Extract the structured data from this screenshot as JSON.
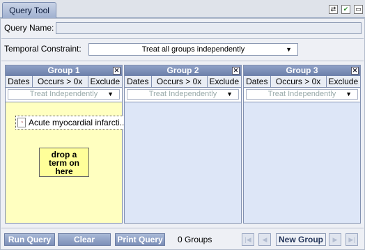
{
  "tab": {
    "label": "Query Tool"
  },
  "toolbar_icons": [
    "export-icon",
    "checkmark-icon",
    "restore-window-icon"
  ],
  "query_name": {
    "label": "Query Name:",
    "value": ""
  },
  "temporal": {
    "label": "Temporal Constraint:",
    "value": "Treat all groups independently"
  },
  "groups": [
    {
      "title": "Group 1",
      "tabs": [
        "Dates",
        "Occurs > 0x",
        "Exclude"
      ],
      "timing": "Treat Independently",
      "term": "Acute myocardial infarcti...",
      "drop_hint": "drop a term on here"
    },
    {
      "title": "Group 2",
      "tabs": [
        "Dates",
        "Occurs > 0x",
        "Exclude"
      ],
      "timing": "Treat Independently"
    },
    {
      "title": "Group 3",
      "tabs": [
        "Dates",
        "Occurs > 0x",
        "Exclude"
      ],
      "timing": "Treat Independently"
    }
  ],
  "footer": {
    "run_query": "Run Query",
    "clear": "Clear",
    "print_query": "Print Query",
    "groups_count": "0 Groups",
    "new_group": "New Group"
  },
  "colors": {
    "group_header": "#7b8fb8",
    "drop_zone_active": "#ffffc0",
    "drop_zone": "#dde6f7",
    "button": "#8c9fc6"
  }
}
